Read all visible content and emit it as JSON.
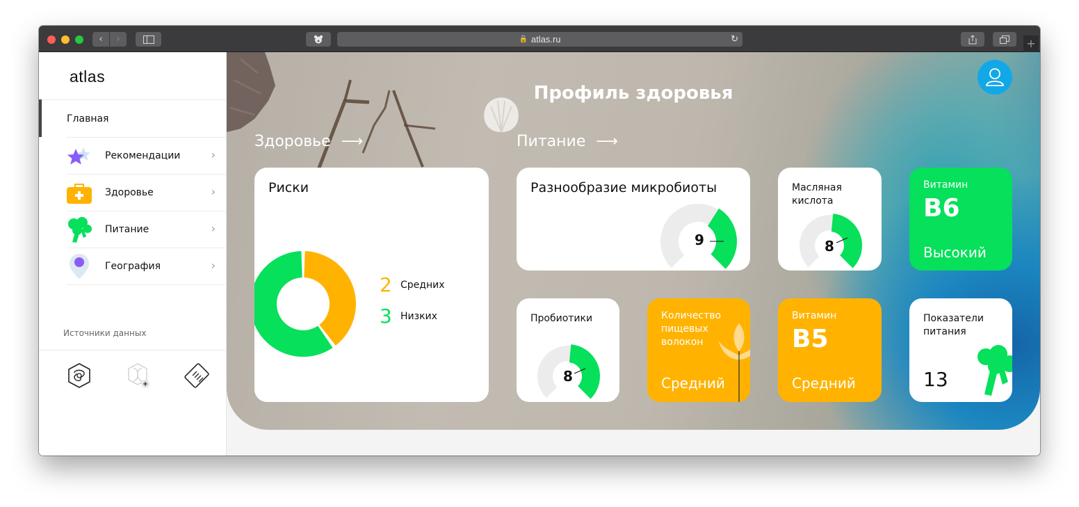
{
  "browser": {
    "url": "atlas.ru",
    "colors": {
      "close": "#ff5f57",
      "minimize": "#febc2e",
      "maximize": "#28c840"
    }
  },
  "sidebar": {
    "logo": "atlas",
    "home": "Главная",
    "items": [
      {
        "label": "Рекомендации",
        "icon": "star-icon"
      },
      {
        "label": "Здоровье",
        "icon": "medkit-icon"
      },
      {
        "label": "Питание",
        "icon": "broccoli-icon"
      },
      {
        "label": "География",
        "icon": "location-pin-icon"
      }
    ],
    "sources_label": "Источники данных",
    "source_icons": [
      "microbiome-icon",
      "dna-add-icon",
      "lab-report-icon"
    ]
  },
  "main": {
    "title": "Профиль здоровья",
    "sections": {
      "health": "Здоровье",
      "nutrition": "Питание"
    },
    "risks": {
      "title": "Риски",
      "items": [
        {
          "count": "2",
          "label": "Средних",
          "color": "#ffb300"
        },
        {
          "count": "3",
          "label": "Низких",
          "color": "#06e05a"
        }
      ]
    },
    "microbiota": {
      "title": "Разнообразие микробиоты",
      "score": "9",
      "max": 10
    },
    "butyric": {
      "title": "Масляная кислота",
      "score": "8",
      "max": 10
    },
    "vitamin_b6": {
      "title": "Витамин",
      "name": "B6",
      "level": "Высокий"
    },
    "probiotics": {
      "title": "Пробиотики",
      "score": "8",
      "max": 10
    },
    "fiber": {
      "title": "Количество пищевых волокон",
      "level": "Средний"
    },
    "vitamin_b5": {
      "title": "Витамин",
      "name": "B5",
      "level": "Средний"
    },
    "indicators": {
      "title": "Показатели питания",
      "value": "13"
    }
  }
}
